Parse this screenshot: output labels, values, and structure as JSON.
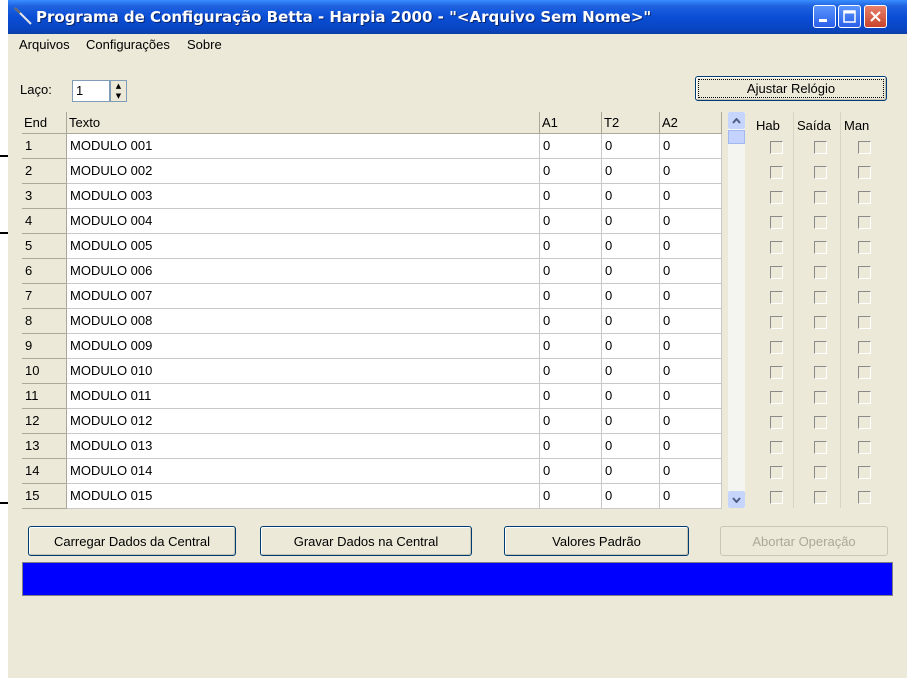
{
  "window": {
    "title": "Programa de Configuração Betta - Harpia 2000 - \"<Arquivo Sem Nome>\""
  },
  "menu": [
    "Arquivos",
    "Configurações",
    "Sobre"
  ],
  "laco": {
    "label": "Laço:",
    "value": "1"
  },
  "buttons": {
    "ajustar": "Ajustar Relógio",
    "carregar": "Carregar Dados da Central",
    "gravar": "Gravar Dados na Central",
    "valores": "Valores Padrão",
    "abortar": "Abortar Operação"
  },
  "grid": {
    "headers": [
      "End",
      "Texto",
      "A1",
      "T2",
      "A2"
    ],
    "rows": [
      [
        "1",
        "MODULO 001",
        "0",
        "0",
        "0"
      ],
      [
        "2",
        "MODULO 002",
        "0",
        "0",
        "0"
      ],
      [
        "3",
        "MODULO 003",
        "0",
        "0",
        "0"
      ],
      [
        "4",
        "MODULO 004",
        "0",
        "0",
        "0"
      ],
      [
        "5",
        "MODULO 005",
        "0",
        "0",
        "0"
      ],
      [
        "6",
        "MODULO 006",
        "0",
        "0",
        "0"
      ],
      [
        "7",
        "MODULO 007",
        "0",
        "0",
        "0"
      ],
      [
        "8",
        "MODULO 008",
        "0",
        "0",
        "0"
      ],
      [
        "9",
        "MODULO 009",
        "0",
        "0",
        "0"
      ],
      [
        "10",
        "MODULO 010",
        "0",
        "0",
        "0"
      ],
      [
        "11",
        "MODULO 011",
        "0",
        "0",
        "0"
      ],
      [
        "12",
        "MODULO 012",
        "0",
        "0",
        "0"
      ],
      [
        "13",
        "MODULO 013",
        "0",
        "0",
        "0"
      ],
      [
        "14",
        "MODULO 014",
        "0",
        "0",
        "0"
      ],
      [
        "15",
        "MODULO 015",
        "0",
        "0",
        "0"
      ]
    ]
  },
  "flags": {
    "headers": [
      "Hab",
      "Saída",
      "Man"
    ]
  },
  "colors": {
    "titlebar": "#0a4ed6",
    "progress": "#0000ff",
    "face": "#ece9d8"
  }
}
